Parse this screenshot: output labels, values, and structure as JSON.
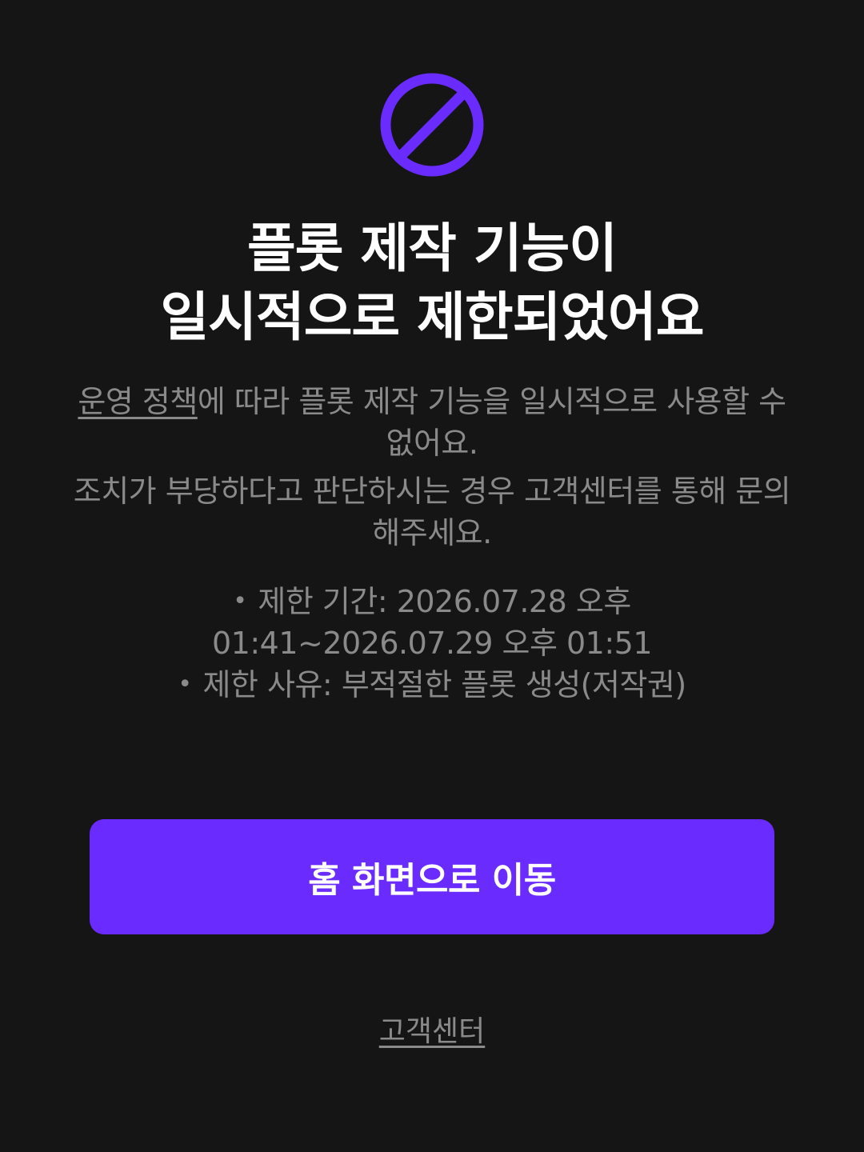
{
  "icon": {
    "name": "block-icon",
    "color": "#6a2bff"
  },
  "title": {
    "line1": "플롯 제작 기능이",
    "line2": "일시적으로 제한되었어요"
  },
  "description": {
    "policy_link": "운영 정책",
    "para1_rest": "에 따라 플롯 제작 기능을 일시적으로 사용할 수 없어요.",
    "para2": "조치가 부당하다고 판단하시는 경우 고객센터를 통해 문의해주세요."
  },
  "restriction": {
    "bullet": "•",
    "period": "제한 기간: 2026.07.28 오후 01:41~2026.07.29 오후 01:51",
    "reason": "제한 사유: 부적절한 플롯 생성(저작권)"
  },
  "buttons": {
    "home_label": "홈 화면으로 이동",
    "support_label": "고객센터"
  },
  "colors": {
    "background": "#151515",
    "accent": "#6a2bff",
    "muted_text": "#8a8a8a",
    "primary_text": "#ffffff"
  }
}
